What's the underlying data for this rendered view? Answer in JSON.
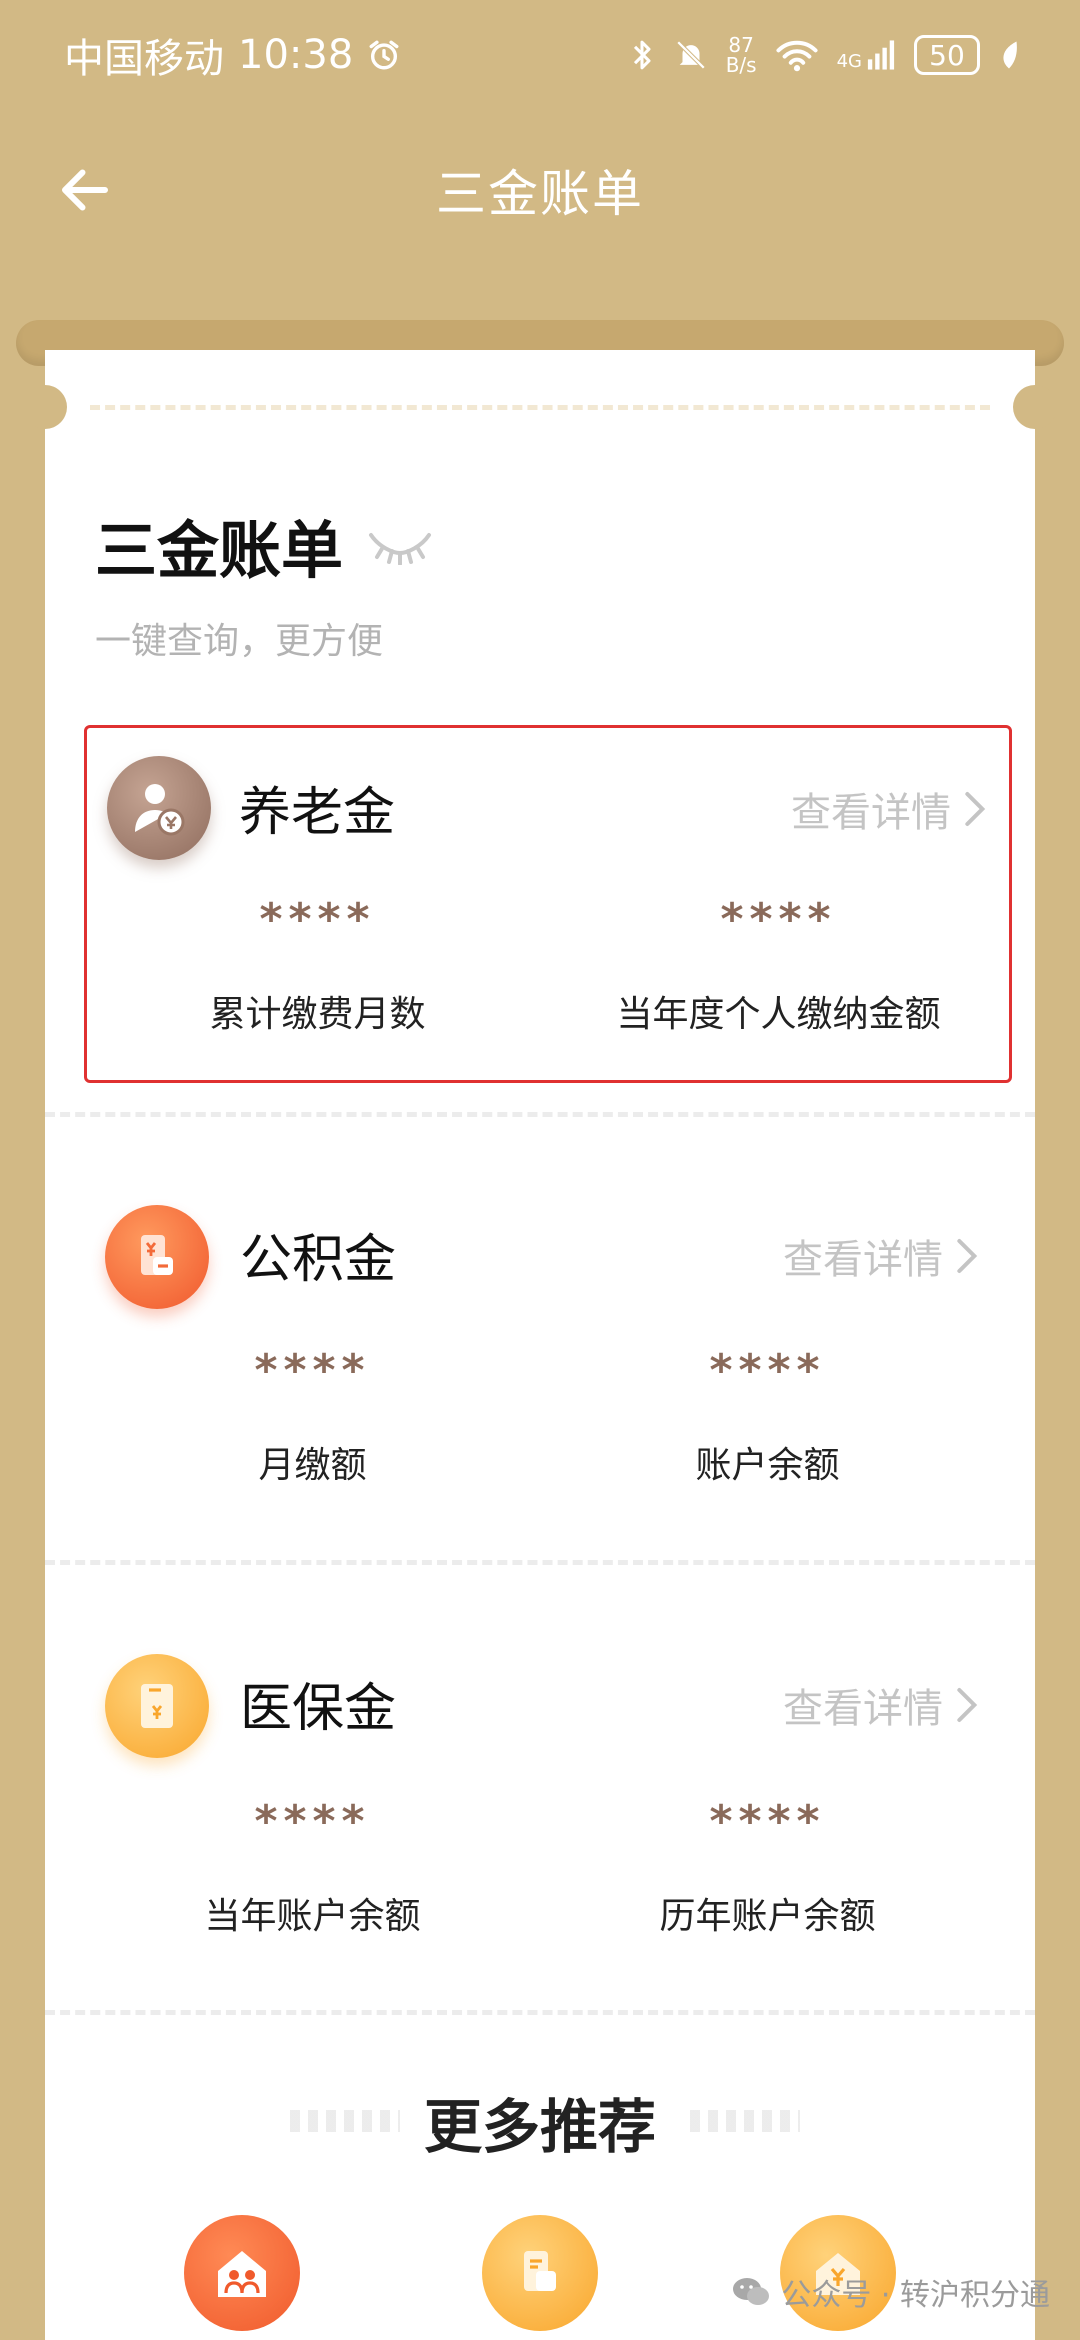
{
  "status_bar": {
    "carrier": "中国移动",
    "time": "10:38",
    "net_speed_top": "87",
    "net_speed_bottom": "B/s",
    "network": "4G",
    "battery": "50"
  },
  "nav": {
    "title": "三金账单"
  },
  "header": {
    "title": "三金账单",
    "subtitle": "一键查询，更方便"
  },
  "sections": [
    {
      "title": "养老金",
      "link": "查看详情",
      "left_value": "****",
      "left_label": "累计缴费月数",
      "right_value": "****",
      "right_label": "当年度个人缴纳金额",
      "icon": "pension-icon",
      "color": "#a78372"
    },
    {
      "title": "公积金",
      "link": "查看详情",
      "left_value": "****",
      "left_label": "月缴额",
      "right_value": "****",
      "right_label": "账户余额",
      "icon": "housing-fund-icon",
      "color": "#f36a39"
    },
    {
      "title": "医保金",
      "link": "查看详情",
      "left_value": "****",
      "left_label": "当年账户余额",
      "right_value": "****",
      "right_label": "历年账户余额",
      "icon": "medical-insurance-icon",
      "color": "#fcb33f"
    }
  ],
  "more": {
    "title": "更多推荐"
  },
  "watermark": {
    "text": "公众号 · 转沪积分通"
  },
  "colors": {
    "background": "#d2b985",
    "highlight_border": "#e03131",
    "masked_value": "#8a6a5a"
  }
}
